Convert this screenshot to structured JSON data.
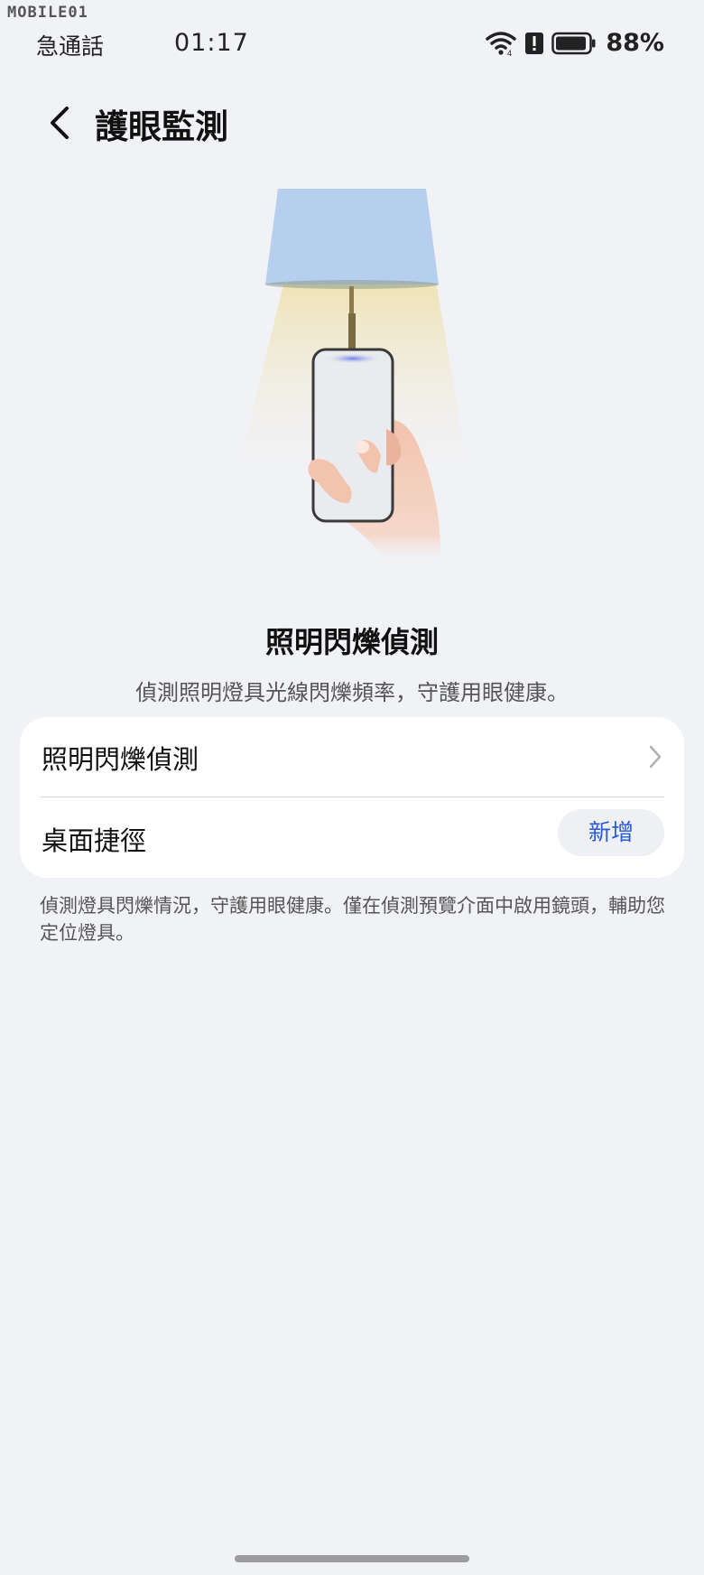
{
  "watermark": {
    "text": "MOBILE01"
  },
  "status_bar": {
    "carrier": "急通話",
    "time": "01:17",
    "battery": "88%",
    "icons": [
      "wifi-icon",
      "alert-icon",
      "battery-icon"
    ]
  },
  "header": {
    "title": "護眼監測",
    "back_icon": "chevron-left-icon"
  },
  "illustration": {
    "description_icon": "lamp-phone-illustration",
    "colors": {
      "lampshade": "#b7cfee",
      "light": "#f0dea0",
      "phone_screen": "#e9ebef",
      "hand": "#f2c9b4"
    }
  },
  "feature": {
    "title": "照明閃爍偵測",
    "description": "偵測照明燈具光線閃爍頻率，守護用眼健康。"
  },
  "settings": {
    "row1_label": "照明閃爍偵測",
    "row2_label": "桌面捷徑",
    "add_label": "新增"
  },
  "footnote": "偵測燈具閃爍情況，守護用眼健康。僅在偵測預覽介面中啟用鏡頭，輔助您定位燈具。",
  "accent_color": "#2a5bd7"
}
